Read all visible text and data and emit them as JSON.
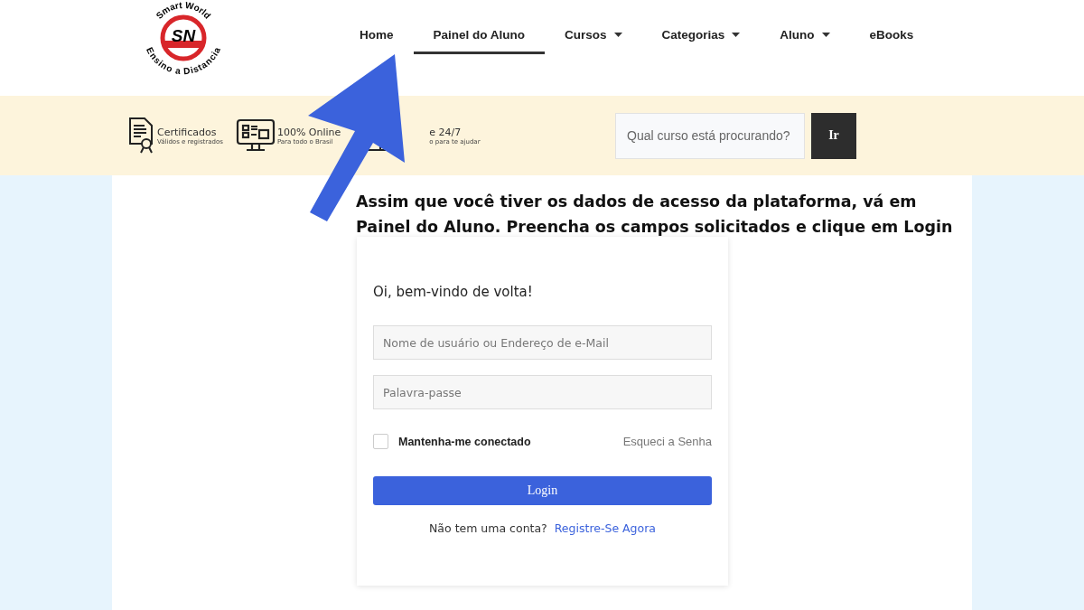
{
  "logo": {
    "top_text": "Smart World",
    "monogram": "SN",
    "bottom_text": "Ensino a Distancia"
  },
  "nav": [
    {
      "label": "Home",
      "selected": false,
      "dropdown": false
    },
    {
      "label": "Painel do Aluno",
      "selected": true,
      "dropdown": false
    },
    {
      "label": "Cursos",
      "selected": false,
      "dropdown": true
    },
    {
      "label": "Categorias",
      "selected": false,
      "dropdown": true
    },
    {
      "label": "Aluno",
      "selected": false,
      "dropdown": true
    },
    {
      "label": "eBooks",
      "selected": false,
      "dropdown": false
    }
  ],
  "features": [
    {
      "kind": "certificate",
      "title": "Certificados",
      "subtitle": "Válidos e registrados"
    },
    {
      "kind": "monitor",
      "title": "100% Online",
      "subtitle": "Para todo o Brasil"
    },
    {
      "kind": "support",
      "title": "e 24/7",
      "subtitle": "o para te ajudar"
    }
  ],
  "search": {
    "placeholder": "Qual curso está procurando?",
    "button": "Ir"
  },
  "annotation": "Assim que você tiver os dados de acesso da plataforma, vá em Painel do Aluno. Preencha os campos solicitados e clique em Login",
  "login": {
    "heading": "Oi, bem-vindo de volta!",
    "username_placeholder": "Nome de usuário ou Endereço de e-Mail",
    "password_placeholder": "Palavra-passe",
    "remember": {
      "label": "Mantenha-me conectado",
      "checked": false
    },
    "forgot": "Esqueci a Senha",
    "submit": "Login",
    "signup_prompt": "Não tem uma conta?",
    "signup_link": "Registre-Se Agora"
  }
}
